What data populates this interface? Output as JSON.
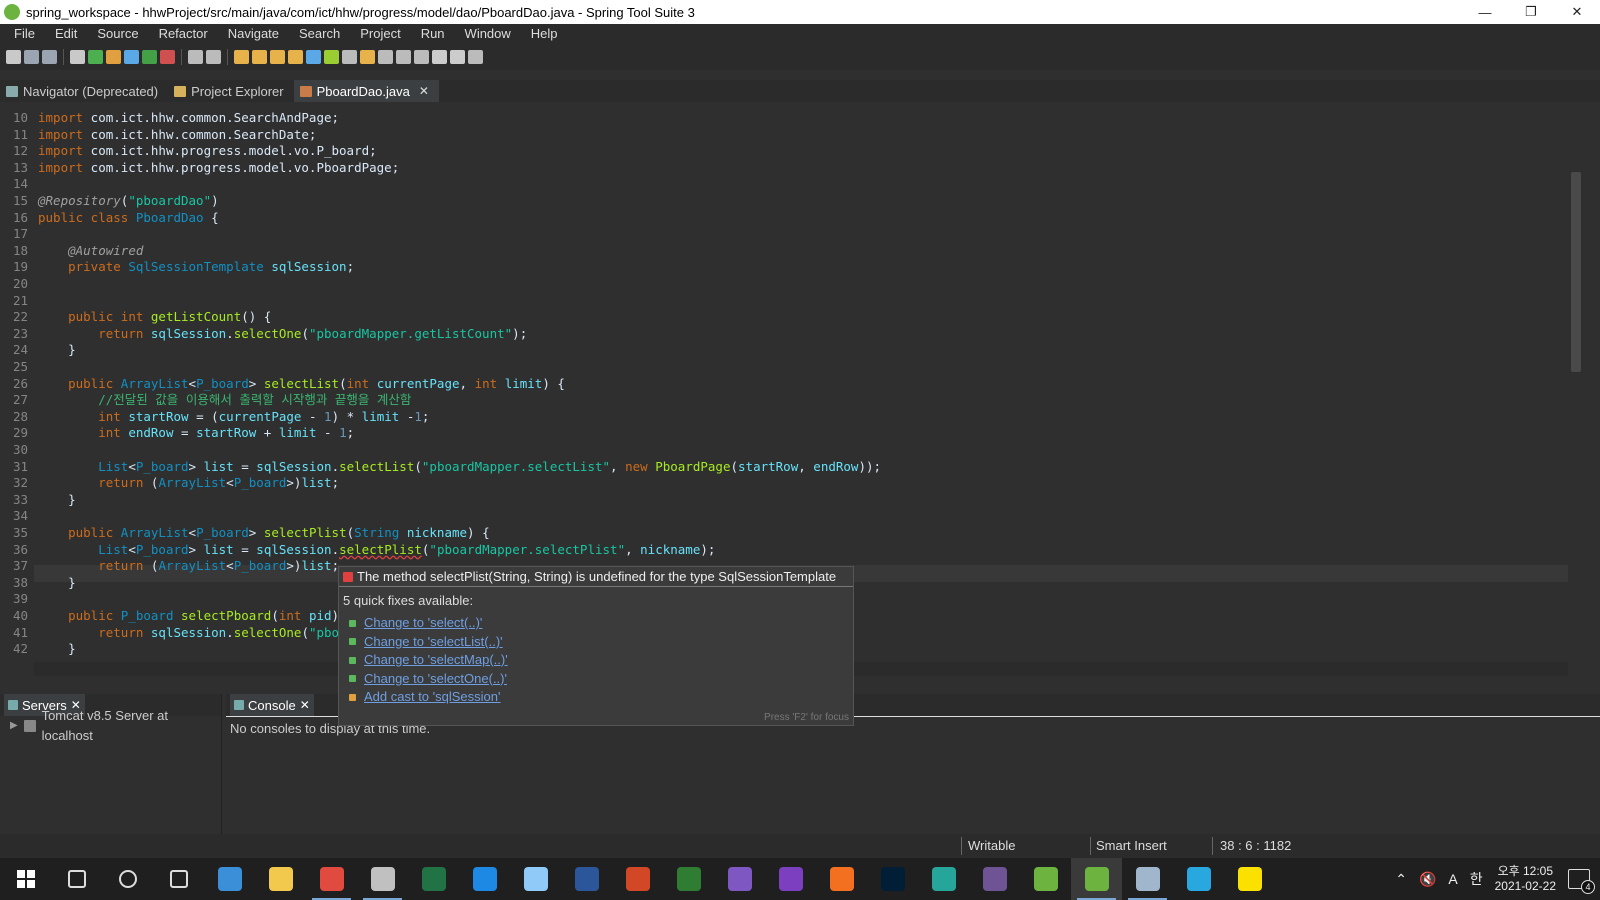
{
  "window": {
    "title": "spring_workspace - hhwProject/src/main/java/com/ict/hhw/progress/model/dao/PboardDao.java - Spring Tool Suite 3"
  },
  "menu": [
    "File",
    "Edit",
    "Source",
    "Refactor",
    "Navigate",
    "Search",
    "Project",
    "Run",
    "Window",
    "Help"
  ],
  "tabs": [
    {
      "label": "Navigator (Deprecated)"
    },
    {
      "label": "Project Explorer"
    },
    {
      "label": "PboardDao.java",
      "closable": true,
      "active": true
    }
  ],
  "code_lines": [
    {
      "n": "10",
      "html": "<span class='kw'>import</span> com.ict.hhw.common.SearchAndPage;"
    },
    {
      "n": "11",
      "html": "<span class='kw'>import</span> com.ict.hhw.common.SearchDate;"
    },
    {
      "n": "12",
      "html": "<span class='kw'>import</span> com.ict.hhw.progress.model.vo.P_board;"
    },
    {
      "n": "13",
      "html": "<span class='kw'>import</span> com.ict.hhw.progress.model.vo.PboardPage;"
    },
    {
      "n": "14",
      "html": ""
    },
    {
      "n": "15",
      "html": "<span class='an'>@Repository</span>(<span class='st'>\"pboardDao\"</span>)"
    },
    {
      "n": "16",
      "html": "<span class='kw'>public class</span> <span class='ty'>PboardDao</span> {"
    },
    {
      "n": "17",
      "html": ""
    },
    {
      "n": "18",
      "html": "    <span class='an'>@Autowired</span>"
    },
    {
      "n": "19",
      "html": "    <span class='kw'>private</span> <span class='ty'>SqlSessionTemplate</span> <span class='fld'>sqlSession</span>;"
    },
    {
      "n": "20",
      "html": ""
    },
    {
      "n": "21",
      "html": ""
    },
    {
      "n": "22",
      "html": "    <span class='kw'>public int</span> <span class='mth'>getListCount</span>() {"
    },
    {
      "n": "23",
      "html": "        <span class='kw'>return</span> <span class='fld'>sqlSession</span>.<span class='mth'>selectOne</span>(<span class='st'>\"pboardMapper.getListCount\"</span>);"
    },
    {
      "n": "24",
      "html": "    }"
    },
    {
      "n": "25",
      "html": ""
    },
    {
      "n": "26",
      "html": "    <span class='kw'>public</span> <span class='ty'>ArrayList</span>&lt;<span class='ty'>P_board</span>&gt; <span class='mth'>selectList</span>(<span class='kw'>int</span> <span class='fld'>currentPage</span>, <span class='kw'>int</span> <span class='fld'>limit</span>) {"
    },
    {
      "n": "27",
      "html": "        <span class='cm'>//전달된 값을 이용해서 출력할 시작행과 끝행을 계산함</span>"
    },
    {
      "n": "28",
      "html": "        <span class='kw'>int</span> <span class='fld'>startRow</span> = (<span class='fld'>currentPage</span> - <span class='num'>1</span>) * <span class='fld'>limit</span> -<span class='num'>1</span>;"
    },
    {
      "n": "29",
      "html": "        <span class='kw'>int</span> <span class='fld'>endRow</span> = <span class='fld'>startRow</span> + <span class='fld'>limit</span> - <span class='num'>1</span>;"
    },
    {
      "n": "30",
      "html": ""
    },
    {
      "n": "31",
      "html": "        <span class='ty'>List</span>&lt;<span class='ty'>P_board</span>&gt; <span class='fld'>list</span> = <span class='fld'>sqlSession</span>.<span class='mth'>selectList</span>(<span class='st'>\"pboardMapper.selectList\"</span>, <span class='kw'>new</span> <span class='mth'>PboardPage</span>(<span class='fld'>startRow</span>, <span class='fld'>endRow</span>));"
    },
    {
      "n": "32",
      "html": "        <span class='kw'>return</span> (<span class='ty'>ArrayList</span>&lt;<span class='ty'>P_board</span>&gt;)<span class='fld'>list</span>;"
    },
    {
      "n": "33",
      "html": "    }"
    },
    {
      "n": "34",
      "html": ""
    },
    {
      "n": "35",
      "html": "    <span class='kw'>public</span> <span class='ty'>ArrayList</span>&lt;<span class='ty'>P_board</span>&gt; <span class='mth'>selectPlist</span>(<span class='ty'>String</span> <span class='fld'>nickname</span>) {"
    },
    {
      "n": "36",
      "html": "        <span class='ty'>List</span>&lt;<span class='ty'>P_board</span>&gt; <span class='fld'>list</span> = <span class='fld'>sqlSession</span>.<span class='mth' style='text-decoration:underline wavy #e04040'>selectPlist</span>(<span class='st'>\"pboardMapper.selectPlist\"</span>, <span class='fld'>nickname</span>);"
    },
    {
      "n": "37",
      "html": "        <span class='kw'>return</span> (<span class='ty'>ArrayList</span>&lt;<span class='ty'>P_board</span>&gt;)<span class='fld'>list</span>;"
    },
    {
      "n": "38",
      "html": "    }"
    },
    {
      "n": "39",
      "html": ""
    },
    {
      "n": "40",
      "html": "    <span class='kw'>public</span> <span class='ty'>P_board</span> <span class='mth'>selectPboard</span>(<span class='kw'>int</span> <span class='fld'>pid</span>) {"
    },
    {
      "n": "41",
      "html": "        <span class='kw'>return</span> <span class='fld'>sqlSession</span>.<span class='mth'>selectOne</span>(<span class='st'>\"pbo</span>"
    },
    {
      "n": "42",
      "html": "    }"
    }
  ],
  "quickfix": {
    "message": "The method selectPlist(String, String) is undefined for the type SqlSessionTemplate",
    "subtitle": "5 quick fixes available:",
    "fixes": [
      "Change to 'select(..)'",
      "Change to 'selectList(..)'",
      "Change to 'selectMap(..)'",
      "Change to 'selectOne(..)'",
      "Add cast to 'sqlSession'"
    ],
    "footer": "Press 'F2' for focus"
  },
  "servers": {
    "tab": "Servers",
    "item": "Tomcat v8.5 Server at localhost"
  },
  "console": {
    "tab": "Console",
    "message": "No consoles to display at this time."
  },
  "status": {
    "writable": "Writable",
    "insert": "Smart Insert",
    "position": "38 : 6 : 1182"
  },
  "taskbar": {
    "time": "오후 12:05",
    "date": "2021-02-22",
    "ime": "A",
    "ime2": "한",
    "notifications": "4",
    "apps": [
      {
        "icon": "search-icon",
        "color": "#1f1f1f"
      },
      {
        "icon": "cortana-icon",
        "color": "#1f1f1f"
      },
      {
        "icon": "task-view-icon",
        "color": "#1f1f1f"
      },
      {
        "icon": "ie-icon",
        "color": "#3a8fd8"
      },
      {
        "icon": "explorer-icon",
        "color": "#f2c94c"
      },
      {
        "icon": "chrome-icon",
        "color": "#e04a3f"
      },
      {
        "icon": "app-icon",
        "color": "#c0c0c0"
      },
      {
        "icon": "excel-icon",
        "color": "#217346"
      },
      {
        "icon": "app2-icon",
        "color": "#1e88e5"
      },
      {
        "icon": "app3-icon",
        "color": "#90caf9"
      },
      {
        "icon": "word-icon",
        "color": "#2b579a"
      },
      {
        "icon": "powerpoint-icon",
        "color": "#d24726"
      },
      {
        "icon": "hs-icon",
        "color": "#2e7d32"
      },
      {
        "icon": "app4-icon",
        "color": "#7e57c2"
      },
      {
        "icon": "vs-icon",
        "color": "#7b3fbf"
      },
      {
        "icon": "vscode-icon",
        "color": "#f37021"
      },
      {
        "icon": "photoshop-icon",
        "color": "#001e36"
      },
      {
        "icon": "app5-icon",
        "color": "#26a69a"
      },
      {
        "icon": "github-icon",
        "color": "#6e5494"
      },
      {
        "icon": "spring-icon",
        "color": "#6db33f"
      },
      {
        "icon": "sts-icon",
        "color": "#6db33f"
      },
      {
        "icon": "db-icon",
        "color": "#9fb6cd"
      },
      {
        "icon": "app6-icon",
        "color": "#29a8e0"
      },
      {
        "icon": "kakaotalk-icon",
        "color": "#fae100"
      }
    ]
  }
}
